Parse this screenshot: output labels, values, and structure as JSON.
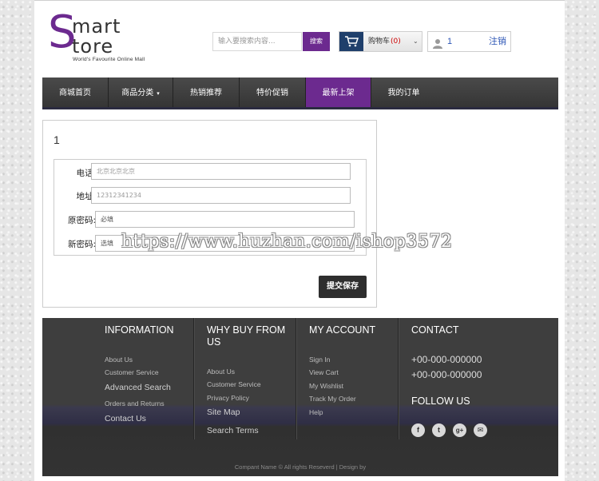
{
  "header": {
    "logo": {
      "initial": "S",
      "line1": "mart",
      "line2": "tore",
      "tagline": "World's Favourite Online Mall"
    },
    "search": {
      "placeholder": "输入要搜索内容...",
      "button": "搜索"
    },
    "cart": {
      "label": "购物车",
      "count": "(0)"
    },
    "user": {
      "name": "1",
      "logout": "注销"
    }
  },
  "nav": {
    "items": [
      {
        "label": "商城首页"
      },
      {
        "label": "商品分类"
      },
      {
        "label": "热销推荐"
      },
      {
        "label": "特价促销"
      },
      {
        "label": "最新上架"
      },
      {
        "label": "我的订单"
      }
    ]
  },
  "form": {
    "title": "1",
    "phone": {
      "label": "电话:",
      "placeholder": "北京北京北京"
    },
    "address": {
      "label": "地址:",
      "placeholder": "12312341234"
    },
    "old_password": {
      "label": "原密码:",
      "value": "必填"
    },
    "new_password": {
      "label": "新密码:",
      "value": "选填"
    },
    "submit": "提交保存"
  },
  "watermark": "https://www.huzhan.com/ishop3572",
  "footer": {
    "information": {
      "heading": "INFORMATION",
      "links": [
        "About Us",
        "Customer Service",
        "Advanced Search",
        "Orders and Returns",
        "Contact Us"
      ]
    },
    "why_buy": {
      "heading": "WHY BUY FROM US",
      "links": [
        "About Us",
        "Customer Service",
        "Privacy Policy",
        "Site Map",
        "Search Terms"
      ]
    },
    "my_account": {
      "heading": "MY ACCOUNT",
      "links": [
        "Sign In",
        "View Cart",
        "My Wishlist",
        "Track My Order",
        "Help"
      ]
    },
    "contact": {
      "heading": "CONTACT",
      "phones": [
        "+00-000-000000",
        "+00-000-000000"
      ],
      "follow_heading": "FOLLOW US",
      "social": [
        {
          "icon": "facebook-icon",
          "glyph": "f"
        },
        {
          "icon": "twitter-icon",
          "glyph": "t"
        },
        {
          "icon": "google-plus-icon",
          "glyph": "g+"
        },
        {
          "icon": "mail-icon",
          "glyph": "✉"
        }
      ]
    },
    "copyright": "Compant Name © All rights Reseverd | Design by"
  },
  "colors": {
    "brand": "#6c2a8f",
    "link": "#2c55b5",
    "cart_count": "#cc0000"
  }
}
